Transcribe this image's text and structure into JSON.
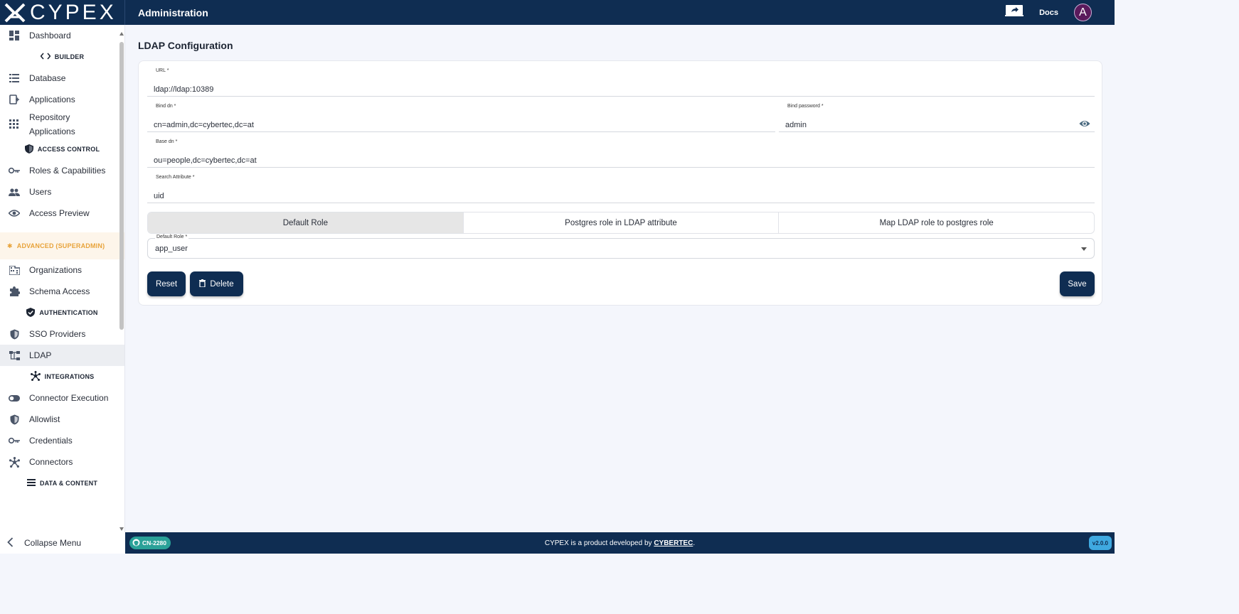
{
  "header": {
    "logo_text": "CYPEX",
    "title": "Administration",
    "docs_label": "Docs",
    "avatar_letter": "A"
  },
  "sidebar": {
    "dashboard": "Dashboard",
    "builder_section": "BUILDER",
    "database": "Database",
    "applications": "Applications",
    "repository_line1": "Repository",
    "repository_line2": "Applications",
    "access_control_section": "ACCESS CONTROL",
    "roles": "Roles & Capabilities",
    "users": "Users",
    "access_preview": "Access Preview",
    "advanced_section": "ADVANCED (SUPERADMIN)",
    "organizations": "Organizations",
    "schema_access": "Schema Access",
    "authentication_section": "AUTHENTICATION",
    "sso_providers": "SSO Providers",
    "ldap": "LDAP",
    "integrations_section": "INTEGRATIONS",
    "connector_execution": "Connector Execution",
    "allowlist": "Allowlist",
    "credentials": "Credentials",
    "connectors": "Connectors",
    "data_content_section": "DATA & CONTENT",
    "collapse_label": "Collapse Menu"
  },
  "main": {
    "page_title": "LDAP Configuration",
    "url": {
      "label": "URL *",
      "value": "ldap://ldap:10389"
    },
    "bind_dn": {
      "label": "Bind dn *",
      "value": "cn=admin,dc=cybertec,dc=at"
    },
    "bind_password": {
      "label": "Bind password *",
      "value": "admin"
    },
    "base_dn": {
      "label": "Base dn *",
      "value": "ou=people,dc=cybertec,dc=at"
    },
    "search_attribute": {
      "label": "Search Attribute *",
      "value": "uid"
    },
    "role_tabs": [
      "Default Role",
      "Postgres role in LDAP attribute",
      "Map LDAP role to postgres role"
    ],
    "default_role": {
      "label": "Default Role *",
      "value": "app_user"
    },
    "reset_label": "Reset",
    "delete_label": "Delete",
    "save_label": "Save"
  },
  "footer": {
    "badge": "CN-2280",
    "text_prefix": "CYPEX is a product developed by ",
    "link": "CYBERTEC",
    "text_suffix": ".",
    "version": "v2.0.0"
  }
}
